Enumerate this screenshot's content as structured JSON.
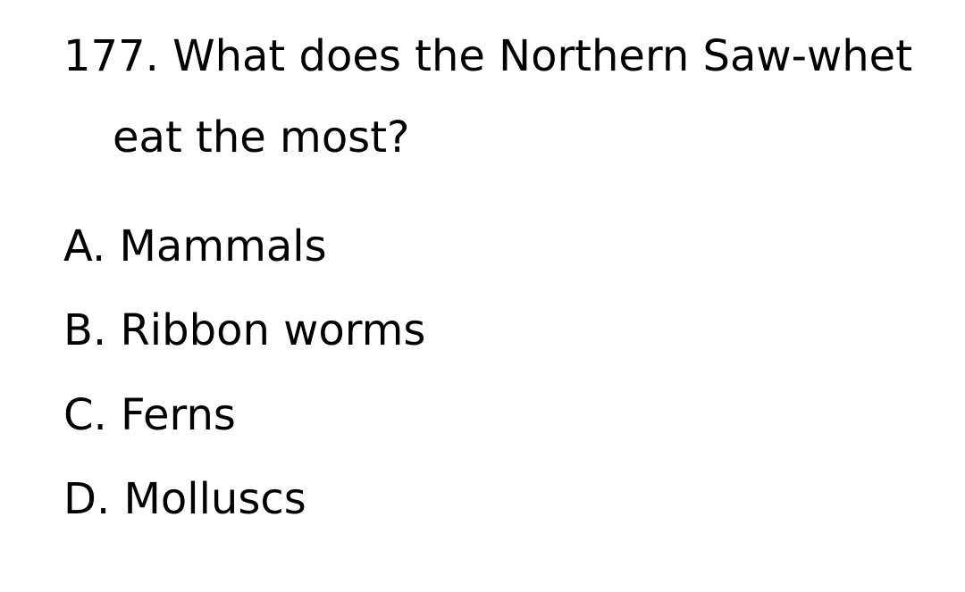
{
  "question": {
    "line1": "177. What does the Northern Saw-whet",
    "line2": "eat the most?"
  },
  "options": [
    "A. Mammals",
    "B. Ribbon worms",
    "C. Ferns",
    "D. Molluscs"
  ]
}
